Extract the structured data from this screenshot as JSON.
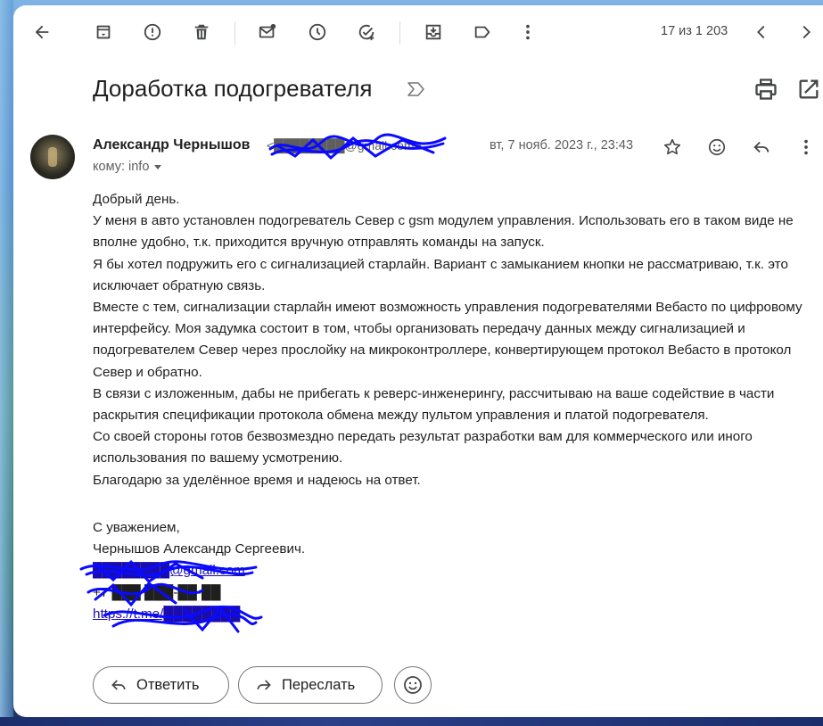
{
  "toolbar": {
    "back_icon": "arrow-left-icon",
    "archive_icon": "archive-icon",
    "spam_icon": "report-spam-icon",
    "delete_icon": "trash-icon",
    "unread_icon": "mark-unread-icon",
    "snooze_icon": "clock-icon",
    "task_icon": "add-task-icon",
    "move_icon": "move-to-icon",
    "label_icon": "label-icon",
    "more_icon": "more-vert-icon",
    "counter": "17 из 1 203",
    "prev_icon": "chevron-left-icon",
    "next_icon": "chevron-right-icon"
  },
  "message": {
    "subject": "Доработка подогревателя",
    "sender_name": "Александр Чернышов",
    "sender_email": "<████████@gmail.com>",
    "to_label": "кому: info",
    "date": "вт, 7 нояб. 2023 г., 23:43",
    "body": [
      "Добрый день.",
      "У меня в авто установлен подогреватель Север с gsm модулем управления. Использовать его в таком виде не вполне удобно, т.к. приходится вручную отправлять команды на запуск.",
      "Я бы хотел подружить его с сигнализацией старлайн. Вариант с замыканием кнопки не рассматриваю, т.к. это исключает обратную связь.",
      "Вместе с тем, сигнализации старлайн имеют возможность управления подогревателями Вебасто по цифровому интерфейсу. Моя задумка состоит в том, чтобы организовать передачу данных между сигнализацией и подогревателем Север через прослойку на микроконтроллере, конвертирующем протокол Вебасто в протокол Север и обратно.",
      "В связи с изложенным, дабы не прибегать к реверс-инженерингу, рассчитываю на ваше содействие в части раскрытия спецификации протокола обмена между пультом управления и платой подогревателя.",
      "Со своей стороны готов безвозмездно передать результат разработки вам для коммерческого или иного использования по вашему усмотрению.",
      "Благодарю за уделённое время и надеюсь на ответ."
    ],
    "signature": {
      "regards": "С уважением,",
      "name": "Чернышов Александр Сергеевич.",
      "email": "████████@gmail.com",
      "phone": "+7 ███ ███-██-██",
      "link": "https://t.me/████████"
    }
  },
  "actions": {
    "reply": "Ответить",
    "forward": "Переслать"
  },
  "colors": {
    "accent_link": "#1a0dab",
    "scribble": "#0a0aff"
  }
}
